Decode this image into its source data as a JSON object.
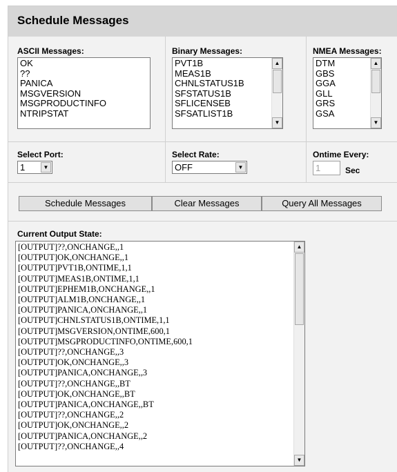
{
  "header": {
    "title": "Schedule Messages"
  },
  "ascii": {
    "label": "ASCII Messages:",
    "items": [
      "OK",
      "??",
      "PANICA",
      "MSGVERSION",
      "MSGPRODUCTINFO",
      "NTRIPSTAT"
    ]
  },
  "binary": {
    "label": "Binary Messages:",
    "items": [
      "PVT1B",
      "MEAS1B",
      "CHNLSTATUS1B",
      "SFSTATUS1B",
      "SFLICENSEB",
      "SFSATLIST1B"
    ]
  },
  "nmea": {
    "label": "NMEA Messages:",
    "items": [
      "DTM",
      "GBS",
      "GGA",
      "GLL",
      "GRS",
      "GSA"
    ]
  },
  "port": {
    "label": "Select Port:",
    "value": "1"
  },
  "rate": {
    "label": "Select Rate:",
    "value": "OFF"
  },
  "ontime": {
    "label": "Ontime Every:",
    "placeholder": "1",
    "unit": "Sec"
  },
  "buttons": {
    "schedule": "Schedule Messages",
    "clear": "Clear Messages",
    "query": "Query All Messages"
  },
  "output": {
    "label": "Current Output State:",
    "lines": [
      "[OUTPUT]??,ONCHANGE,,1",
      "[OUTPUT]OK,ONCHANGE,,1",
      "[OUTPUT]PVT1B,ONTIME,1,1",
      "[OUTPUT]MEAS1B,ONTIME,1,1",
      "[OUTPUT]EPHEM1B,ONCHANGE,,1",
      "[OUTPUT]ALM1B,ONCHANGE,,1",
      "[OUTPUT]PANICA,ONCHANGE,,1",
      "[OUTPUT]CHNLSTATUS1B,ONTIME,1,1",
      "[OUTPUT]MSGVERSION,ONTIME,600,1",
      "[OUTPUT]MSGPRODUCTINFO,ONTIME,600,1",
      "[OUTPUT]??,ONCHANGE,,3",
      "[OUTPUT]OK,ONCHANGE,,3",
      "[OUTPUT]PANICA,ONCHANGE,,3",
      "[OUTPUT]??,ONCHANGE,,BT",
      "[OUTPUT]OK,ONCHANGE,,BT",
      "[OUTPUT]PANICA,ONCHANGE,,BT",
      "[OUTPUT]??,ONCHANGE,,2",
      "[OUTPUT]OK,ONCHANGE,,2",
      "[OUTPUT]PANICA,ONCHANGE,,2",
      "[OUTPUT]??,ONCHANGE,,4"
    ]
  }
}
